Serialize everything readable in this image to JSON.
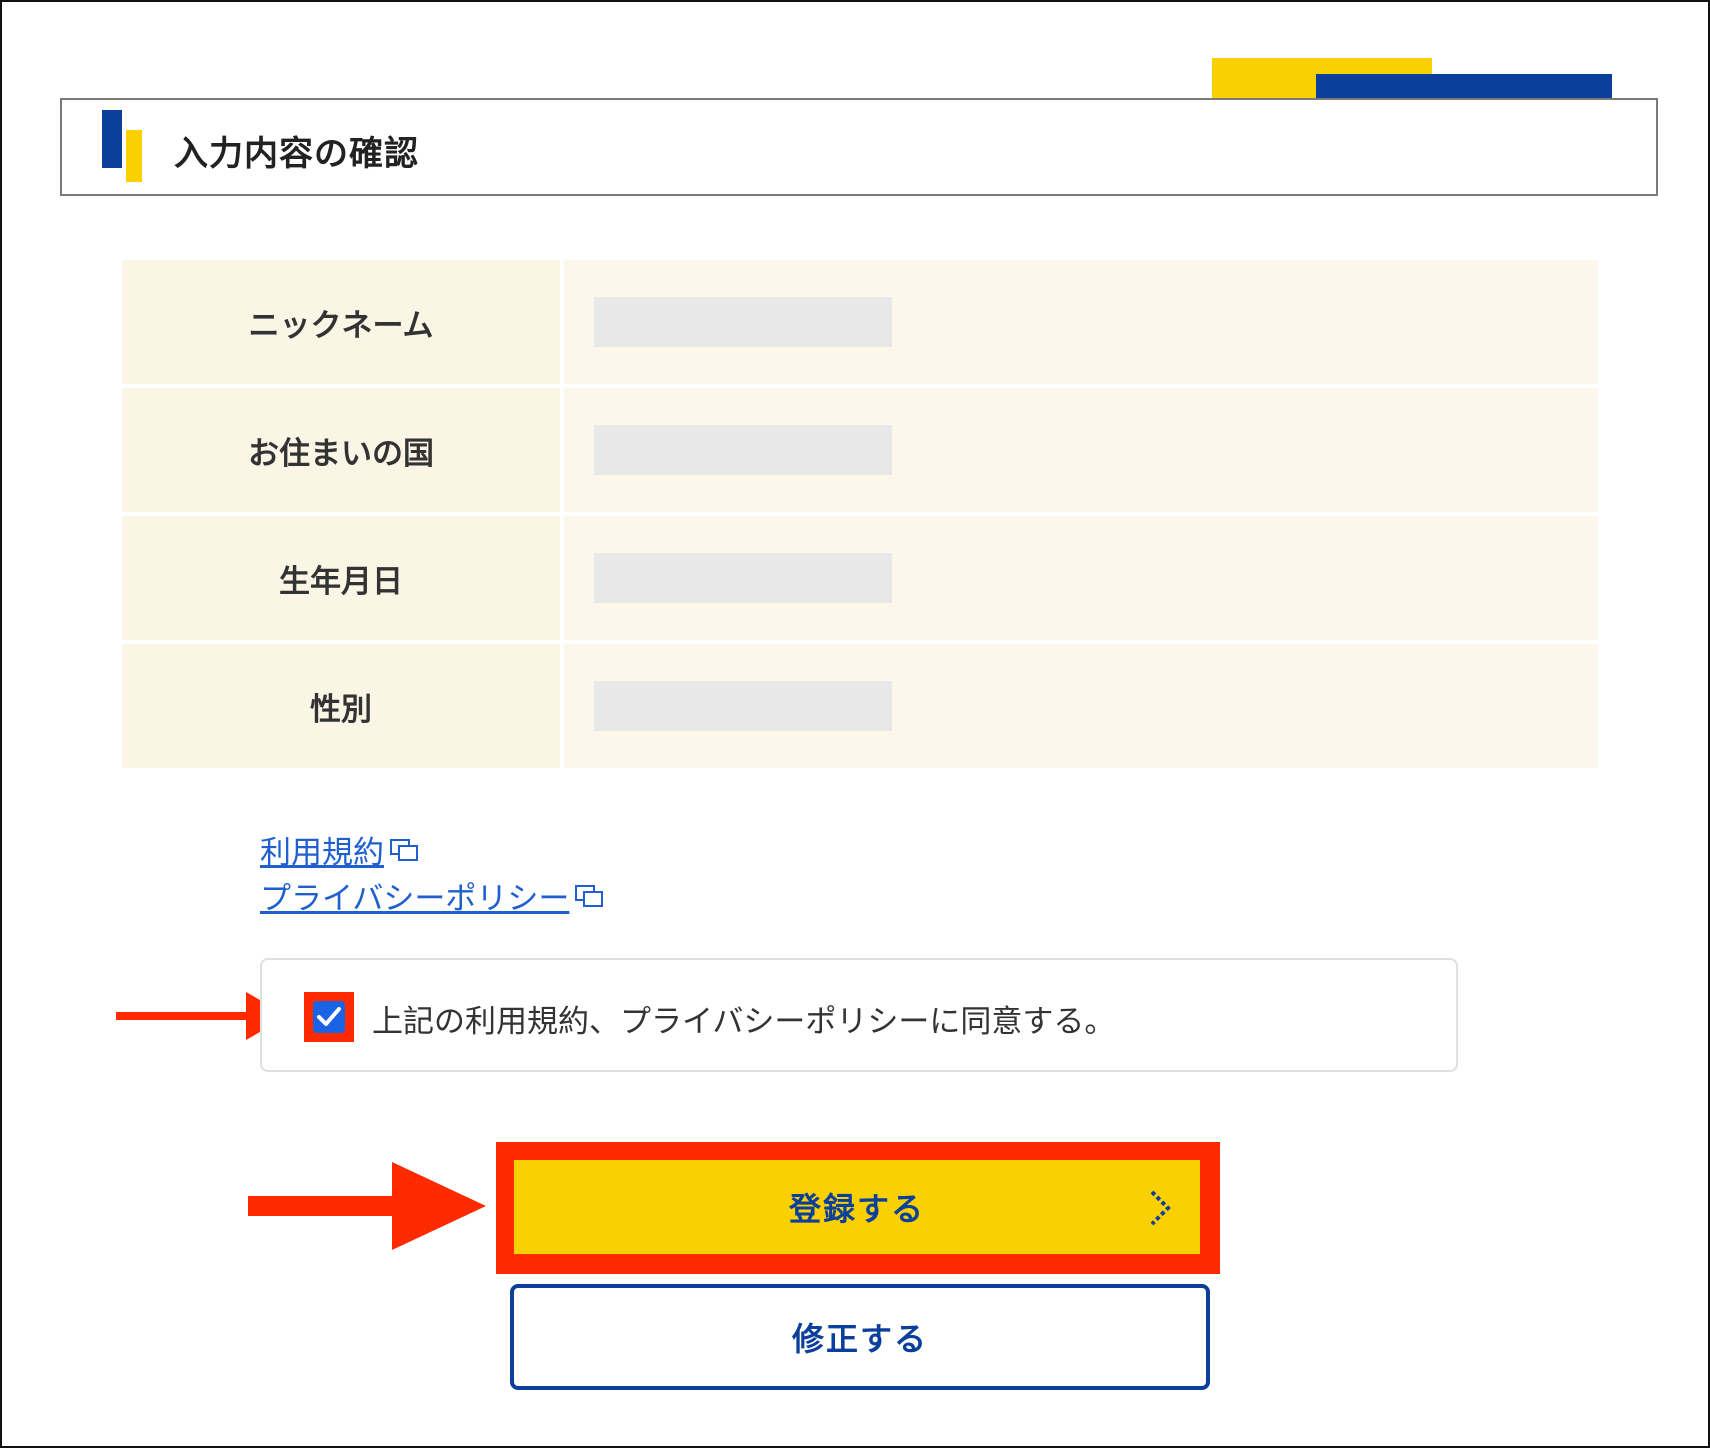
{
  "header": {
    "title": "入力内容の確認"
  },
  "table": {
    "rows": [
      {
        "label": "ニックネーム"
      },
      {
        "label": "お住まいの国"
      },
      {
        "label": "生年月日"
      },
      {
        "label": "性別"
      }
    ]
  },
  "links": {
    "terms": "利用規約",
    "privacy": "プライバシーポリシー"
  },
  "agreement": {
    "checked": true,
    "label": "上記の利用規約、プライバシーポリシーに同意する。"
  },
  "buttons": {
    "submit_label": "登録する",
    "edit_label": "修正する"
  },
  "colors": {
    "brand_yellow": "#fbd000",
    "brand_blue": "#0b3f9c",
    "highlight_red": "#ff2a00",
    "link_blue": "#1f5fcf",
    "table_bg": "#fbf5e6"
  }
}
